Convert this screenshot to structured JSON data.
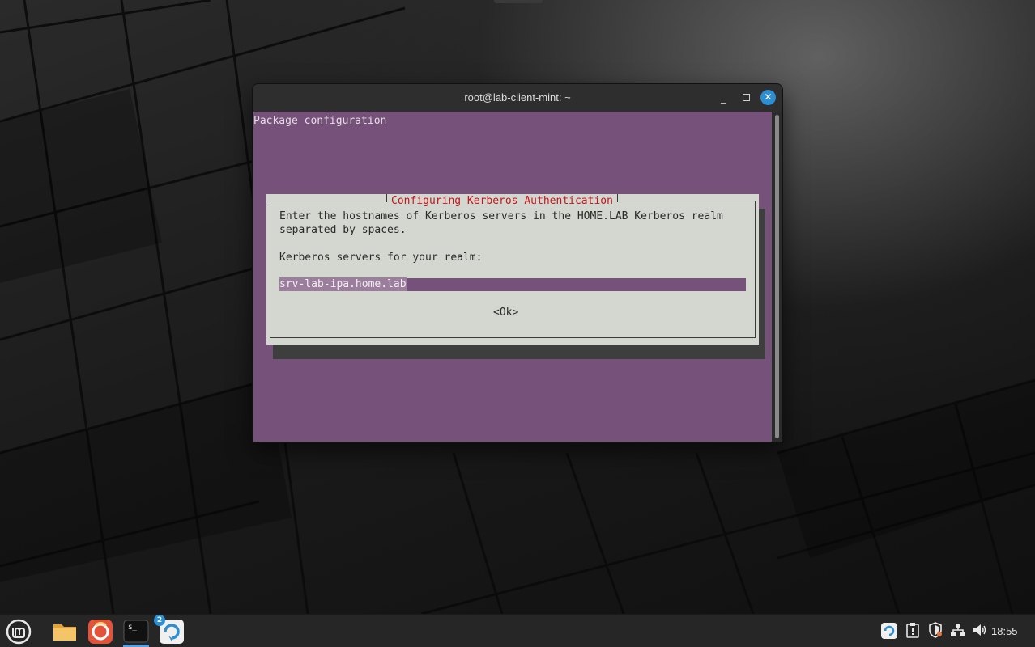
{
  "window": {
    "title": "root@lab-client-mint: ~",
    "minimize_glyph": "_",
    "close_glyph": "✕"
  },
  "terminal": {
    "header": "Package configuration",
    "background_color": "#76517a"
  },
  "dialog": {
    "title": "Configuring Kerberos Authentication",
    "line1": "Enter the hostnames of Kerberos servers in the HOME.LAB Kerberos realm",
    "line2": "separated by spaces.",
    "prompt": "Kerberos servers for your realm:",
    "input_value": "srv-lab-ipa.home.lab",
    "ok_label": "<Ok>"
  },
  "taskbar": {
    "items": [
      {
        "name": "menu",
        "icon": "linux-mint-menu-icon"
      },
      {
        "name": "files",
        "icon": "folder-icon"
      },
      {
        "name": "firefox",
        "icon": "firefox-icon"
      },
      {
        "name": "terminal",
        "icon": "terminal-icon",
        "label": "$_",
        "active": true
      },
      {
        "name": "update-manager",
        "icon": "update-icon",
        "badge": "2"
      }
    ],
    "tray": [
      "update-tray-icon",
      "clipboard-icon",
      "shield-icon",
      "network-icon",
      "volume-icon"
    ],
    "clock": "18:55"
  }
}
